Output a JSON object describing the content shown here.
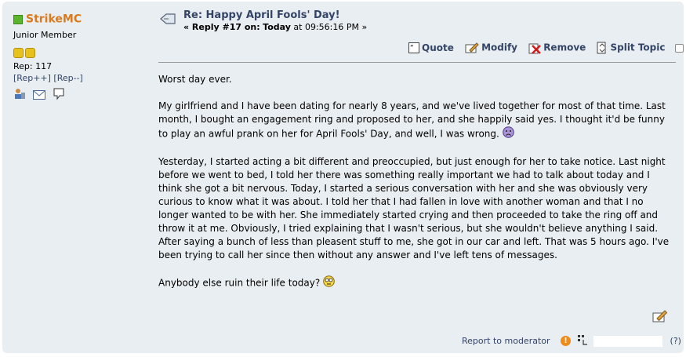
{
  "poster": {
    "name": "StrikeMC",
    "group": "Junior Member",
    "rep": "Rep: 117",
    "rep_plus": "[Rep++]",
    "rep_minus": "[Rep--]",
    "stars": 2
  },
  "header": {
    "subject": "Re: Happy April Fools' Day!",
    "reply_prefix": "« Reply #17 on:",
    "reply_day": "Today",
    "reply_time": "at 09:56:16 PM »"
  },
  "buttons": {
    "quote": "Quote",
    "modify": "Modify",
    "remove": "Remove",
    "split": "Split Topic"
  },
  "body": {
    "p1": "Worst day ever.",
    "p2": "My girlfriend and I have been dating for nearly 8 years, and we've lived together for most of that time. Last month, I bought an engagement ring and proposed to her, and she happily said yes. I thought it'd be funny to play an awful prank on her for April Fools' Day, and well, I was wrong.",
    "p3": "Yesterday, I started acting a bit different and preoccupied, but just enough for her to take notice. Last night before we went to bed, I told her there was something really important we had to talk about today and I think she got a bit nervous. Today, I started a serious conversation with her and she was obviously very curious to know what it was about. I told her that I had fallen in love with another woman and that I no longer wanted to be with her. She immediately started crying and then proceeded to take the ring off and throw it at me. Obviously, I tried explaining that I wasn't serious, but she wouldn't believe anything I said. After saying a bunch of less than pleasent stuff to me, she got in our car and left. That was 5 hours ago. I've been trying to call her since then without any answer and I've left tens of messages.",
    "p4": "Anybody else ruin their life today?"
  },
  "footer": {
    "report": "Report to moderator",
    "ip_help": "(?)"
  },
  "icons": {
    "subject": "xx-post-icon",
    "sad": "sad-smiley-icon",
    "dazed": "dazed-smiley-icon"
  },
  "colors": {
    "poster_name": "#d97b1d",
    "link": "#334466",
    "background": "#e9eef2"
  }
}
